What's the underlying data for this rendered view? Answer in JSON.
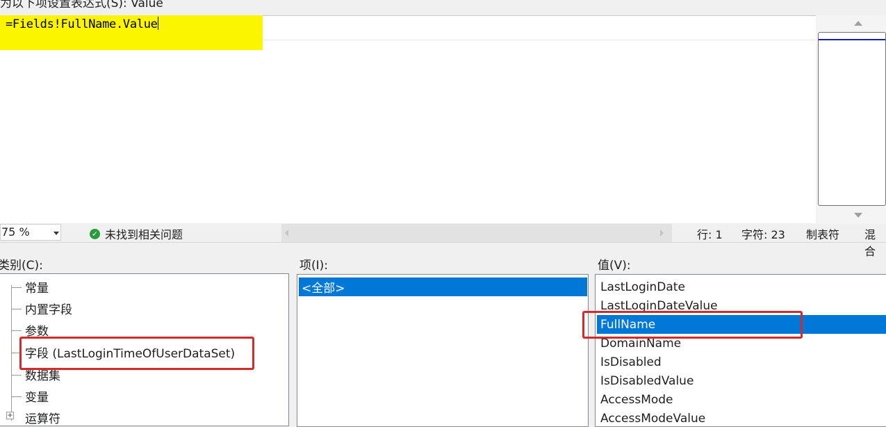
{
  "window": {
    "title": "为以下项设置表达式(S): Value"
  },
  "editor": {
    "expression": "=Fields!FullName.Value",
    "highlight_color": "#fbf600"
  },
  "status_bar": {
    "zoom": "75 %",
    "issues": "未找到相关问题",
    "line": "行: 1",
    "char": "字符: 23",
    "indent": "制表符",
    "line_ending": "混合"
  },
  "categories": {
    "label": "类别(C):",
    "items": [
      "常量",
      "内置字段",
      "参数",
      "字段 (LastLoginTimeOfUserDataSet)",
      "数据集",
      "变量",
      "运算符"
    ],
    "selected": "字段 (LastLoginTimeOfUserDataSet)"
  },
  "items": {
    "label": "项(I):",
    "items": [
      "<全部>"
    ],
    "selected": "<全部>"
  },
  "values": {
    "label": "值(V):",
    "items": [
      "LastLoginDate",
      "LastLoginDateValue",
      "FullName",
      "DomainName",
      "IsDisabled",
      "IsDisabledValue",
      "AccessMode",
      "AccessModeValue"
    ],
    "selected": "FullName"
  },
  "colors": {
    "selection": "#0078d7",
    "annotation_red": "#d32b2b",
    "ok_green": "#2a9b3d"
  },
  "icons": [
    "check-circle-icon",
    "dropdown-arrow-icon",
    "scroll-up-icon",
    "scroll-down-icon",
    "expand-plus-icon"
  ]
}
